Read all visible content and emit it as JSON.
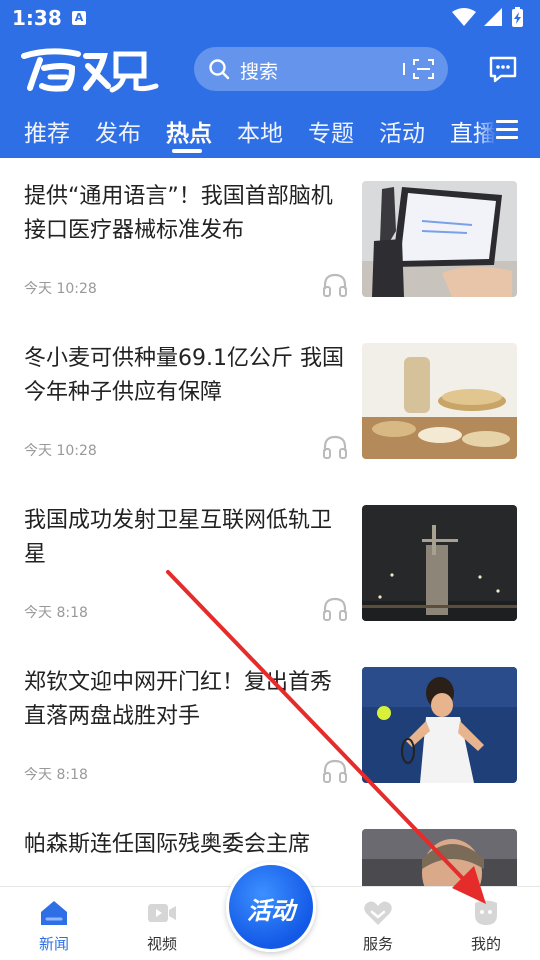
{
  "status_bar": {
    "time": "1:38",
    "notif_letter": "A"
  },
  "header": {
    "logo_text": "百观",
    "search_placeholder": "搜索",
    "tabs": [
      {
        "label": "推荐"
      },
      {
        "label": "发布"
      },
      {
        "label": "热点",
        "active": true
      },
      {
        "label": "本地"
      },
      {
        "label": "专题"
      },
      {
        "label": "活动"
      },
      {
        "label": "直播"
      }
    ]
  },
  "feed": [
    {
      "title": "提供“通用语言”！我国首部脑机接口医疗器械标准发布",
      "time": "今天 10:28"
    },
    {
      "title": "冬小麦可供种量69.1亿公斤 我国今年种子供应有保障",
      "time": "今天 10:28"
    },
    {
      "title": "我国成功发射卫星互联网低轨卫星",
      "time": "今天 8:18"
    },
    {
      "title": "郑钦文迎中网开门红！复出首秀直落两盘战胜对手",
      "time": "今天 8:18"
    },
    {
      "title": "帕森斯连任国际残奥委会主席",
      "time": ""
    }
  ],
  "bottom_nav": {
    "items": [
      {
        "label": "新闻",
        "active": true
      },
      {
        "label": "视频"
      },
      {
        "label": "服务"
      },
      {
        "label": "我的"
      }
    ],
    "center_label": "活动"
  },
  "colors": {
    "primary": "#2f6fe6",
    "annotation_arrow": "#e62b2b"
  }
}
